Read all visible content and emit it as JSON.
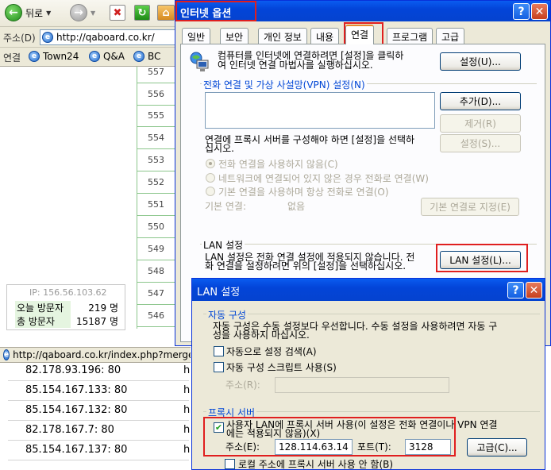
{
  "browser": {
    "back_label": "뒤로",
    "address_label": "주소(D)",
    "address_url": "http://qaboard.co.kr/",
    "links_label": "연결",
    "links": [
      "Town24",
      "Q&A",
      "BC"
    ],
    "status_url": "http://qaboard.co.kr/index.php?merge"
  },
  "board": {
    "row_numbers": [
      "557",
      "556",
      "555",
      "554",
      "553",
      "552",
      "551",
      "550",
      "549",
      "548",
      "547",
      "546"
    ],
    "visitor": {
      "ip": "IP: 156.56.103.62",
      "today_label": "오늘 방문자",
      "today_value": "219 명",
      "total_label": "총 방문자",
      "total_value": "15187 명"
    }
  },
  "proxy_list": [
    {
      "ip": "82.178.93.196: 80",
      "col": "h"
    },
    {
      "ip": "85.154.167.133: 80",
      "col": "h"
    },
    {
      "ip": "85.154.167.132: 80",
      "col": "h"
    },
    {
      "ip": "82.178.167.7: 80",
      "col": "h"
    },
    {
      "ip": "85.154.167.137: 80",
      "col": "h"
    }
  ],
  "internet_options": {
    "title": "인터넷 옵션",
    "help_glyph": "?",
    "close_glyph": "✕",
    "tabs": [
      "일반",
      "보안",
      "개인 정보",
      "내용",
      "연결",
      "프로그램",
      "고급"
    ],
    "setup_text_1": "컴퓨터를 인터넷에 연결하려면 [설정]을 클릭하",
    "setup_text_2": "여 인터넷 연결 마법사를 실행하십시오.",
    "setup_button": "설정(U)...",
    "dialup_group": "전화 연결 및 가상 사설망(VPN) 설정(N)",
    "add_button": "추가(D)...",
    "remove_button": "제거(R)",
    "settings_button": "설정(S)...",
    "proxy_hint_1": "연결에 프록시 서버를 구성해야 하면 [설정]을 선택하",
    "proxy_hint_2": "십시오.",
    "radio_1": "전화 연결을 사용하지 않음(C)",
    "radio_2": "네트워크에 연결되어 있지 않은 경우 전화로 연결(W)",
    "radio_3": "기본 연결을 사용하며 항상 전화로 연결(O)",
    "default_label": "기본 연결:",
    "default_value": "없음",
    "set_default_button": "기본 연결로 지정(E)",
    "lan_group": "LAN 설정",
    "lan_text_1": "LAN 설정은 전화 연결 설정에 적용되지 않습니다. 전",
    "lan_text_2": "화 연결을 설정하려면 위의 [설정]을 선택하십시오.",
    "lan_button": "LAN 설정(L)..."
  },
  "lan_settings": {
    "title": "LAN 설정",
    "help_glyph": "?",
    "close_glyph": "✕",
    "auto_group": "자동 구성",
    "auto_text_1": "자동 구성은 수동 설정보다 우선합니다. 수동 설정을 사용하려면 자동 구",
    "auto_text_2": "성을 사용하지 마십시오.",
    "auto_detect": "자동으로 설정 검색(A)",
    "auto_script": "자동 구성 스크립트 사용(S)",
    "address_label": "주소(R):",
    "address_value": "",
    "proxy_group": "프록시 서버",
    "use_proxy_1": "사용자 LAN에 프록시 서버 사용(이 설정은 전화 연결이나 VPN 연결",
    "use_proxy_2": "에는 적용되지 않음)(X)",
    "proxy_address_label": "주소(E):",
    "proxy_address": "128.114.63.14",
    "port_label": "포트(T):",
    "port": "3128",
    "advanced_button": "고급(C)...",
    "bypass_local": "로컬 주소에 프록시 서버 사용 안 함(B)"
  }
}
